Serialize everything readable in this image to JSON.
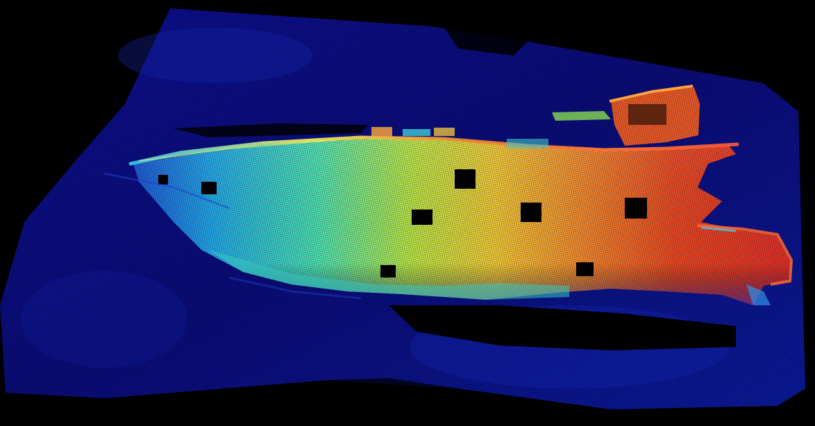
{
  "scene": {
    "subject": "multibeam-sonar-point-cloud",
    "background_color": "#000000",
    "seabed_color": "#0a0c7a",
    "colormap": [
      "#0b0a8a",
      "#1530c8",
      "#1e6fe0",
      "#22b8e8",
      "#3fe0c8",
      "#8ce868",
      "#e8e040",
      "#f0a030",
      "#e85a20",
      "#d82020"
    ]
  }
}
